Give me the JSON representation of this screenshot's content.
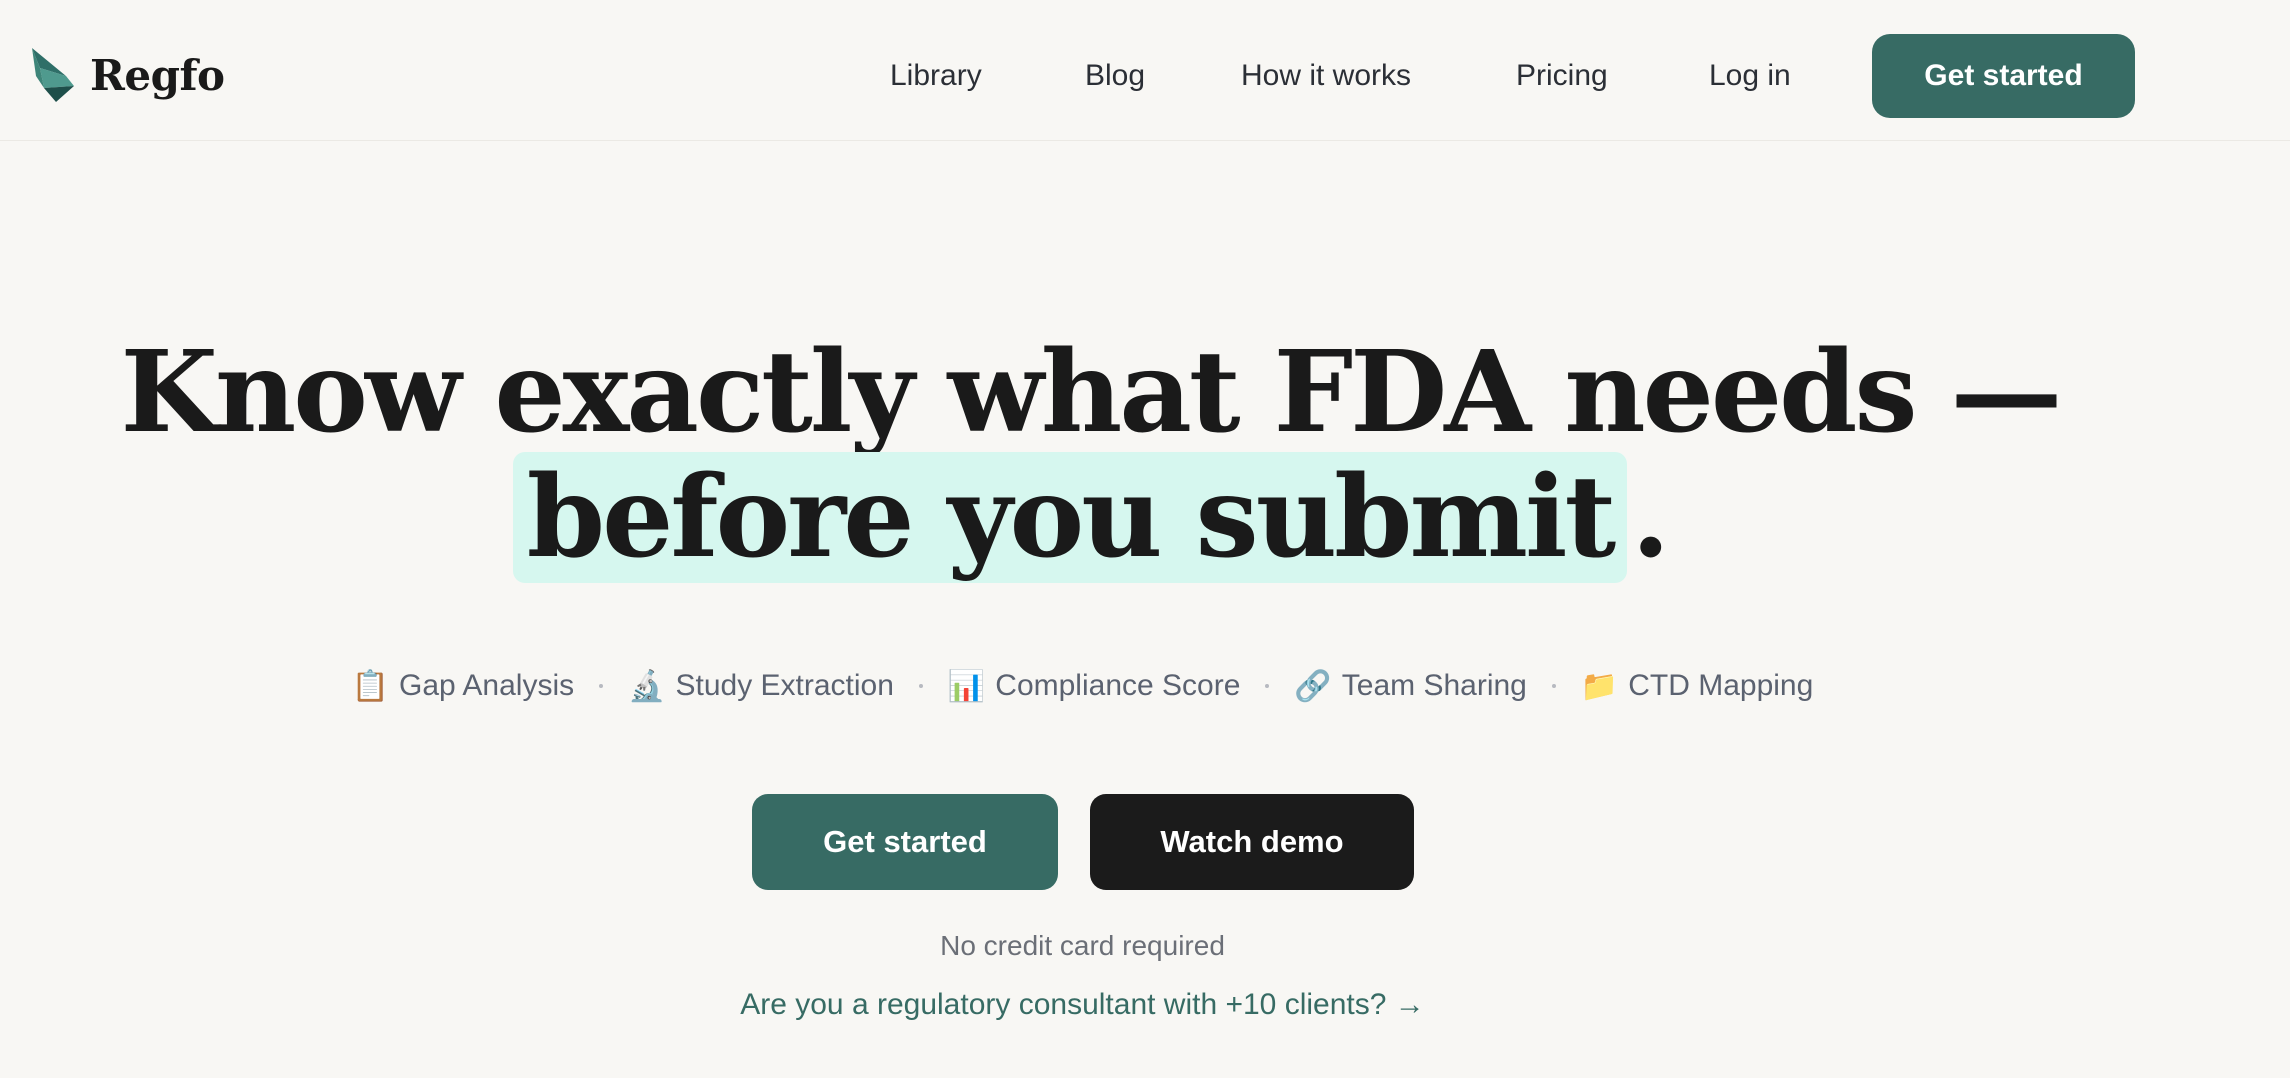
{
  "brand": {
    "name": "Regfo",
    "accent": "#376b64",
    "dark": "#1b1b1b",
    "highlight": "#d6f7ef"
  },
  "nav": {
    "library": "Library",
    "blog": "Blog",
    "how_it_works": "How it works",
    "pricing": "Pricing",
    "login": "Log in",
    "cta": "Get started"
  },
  "hero": {
    "line1": "Know exactly what FDA needs —",
    "line2_highlight": "before you submit",
    "line2_end": "."
  },
  "features": [
    {
      "icon": "📋",
      "icon_name": "clipboard-icon",
      "label": "Gap Analysis"
    },
    {
      "icon": "🔬",
      "icon_name": "microscope-icon",
      "label": "Study Extraction"
    },
    {
      "icon": "📊",
      "icon_name": "bar-chart-icon",
      "label": "Compliance Score"
    },
    {
      "icon": "🔗",
      "icon_name": "link-icon",
      "label": "Team Sharing"
    },
    {
      "icon": "📁",
      "icon_name": "folder-icon",
      "label": "CTD Mapping"
    }
  ],
  "cta": {
    "primary": "Get started",
    "secondary": "Watch demo",
    "note": "No credit card required",
    "consultant_link": "Are you a regulatory consultant with +10 clients? →"
  }
}
